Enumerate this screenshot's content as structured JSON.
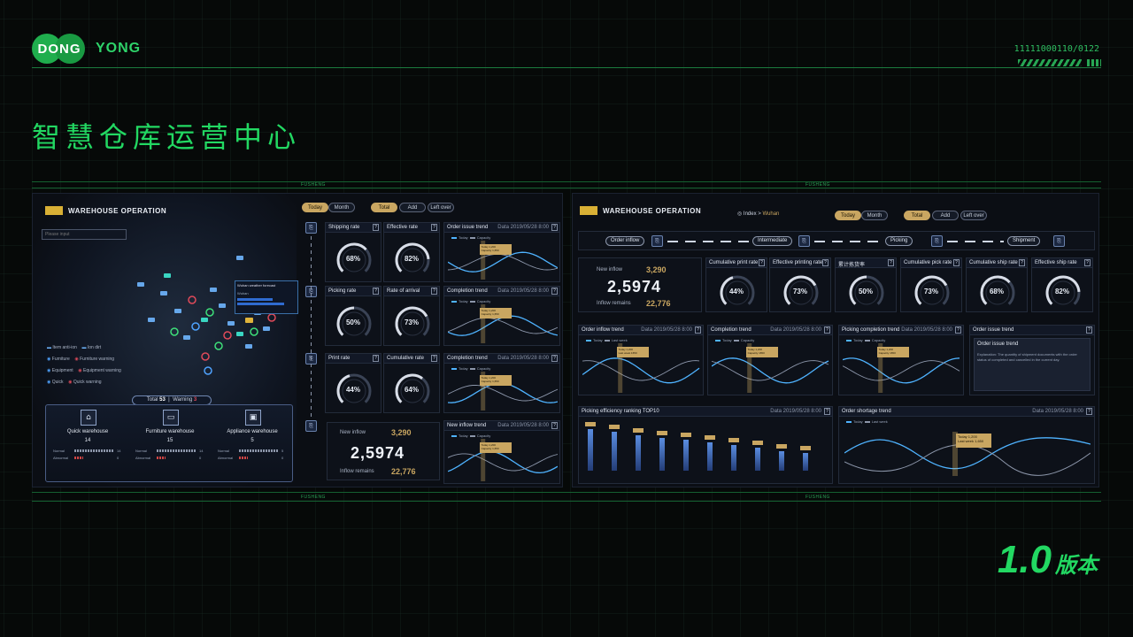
{
  "brand": {
    "left": "DONG",
    "right": "YONG"
  },
  "code": "11111000110/0122",
  "title": "智慧仓库运营中心",
  "rule_label": "FUSHENG",
  "version": {
    "number": "1.0",
    "suffix": "版本"
  },
  "colors": {
    "accent": "#22d862",
    "gold": "#c9a661",
    "panel": "#0d1119",
    "line": "#4fb3ff"
  },
  "left_screen": {
    "brand_title": "WAREHOUSE OPERATION",
    "search_placeholder": "Please input",
    "toggle": {
      "today": "Today",
      "month": "Month"
    },
    "tabs": {
      "total": "Total",
      "add": "Add",
      "leftover": "Left over"
    },
    "tooltip": {
      "title": "Wuhan weather forecast",
      "line2": "Wuhan"
    },
    "legend": [
      {
        "label": "Item anti-ion",
        "status": "Ion dirt"
      },
      {
        "label": "Furniture",
        "status": "Furniture warning"
      },
      {
        "label": "Equipment",
        "status": "Equipment warning"
      },
      {
        "label": "Quick",
        "status": "Quick warning"
      }
    ],
    "summary": {
      "total_label": "Total",
      "total": "53",
      "warning_label": "Warning",
      "warning": "3"
    },
    "warehouses": [
      {
        "name": "Quick warehouse",
        "value": "14",
        "unit": "",
        "normal_label": "Normal",
        "abnormal_label": "Abnormal",
        "normal_count": "14",
        "abnormal_count": "0"
      },
      {
        "name": "Furniture warehouse",
        "value": "15",
        "unit": "",
        "normal_label": "Normal",
        "abnormal_label": "Abnormal",
        "normal_count": "14",
        "abnormal_count": "0"
      },
      {
        "name": "Appliance warehouse",
        "value": "5",
        "unit": "",
        "normal_label": "Normal",
        "abnormal_label": "Abnormal",
        "normal_count": "5",
        "abnormal_count": "0"
      }
    ],
    "gauges": [
      {
        "label": "Shipping rate",
        "value": "68%",
        "pct": 68
      },
      {
        "label": "Effective rate",
        "value": "82%",
        "pct": 82
      },
      {
        "label": "Picking rate",
        "value": "50%",
        "pct": 50
      },
      {
        "label": "Rate of arrival",
        "value": "73%",
        "pct": 73
      },
      {
        "label": "Print rate",
        "value": "44%",
        "pct": 44
      },
      {
        "label": "Cumulative rate",
        "value": "64%",
        "pct": 64
      }
    ],
    "inflow": {
      "new_label": "New inflow",
      "new_value": "3,290",
      "new_unit": "b",
      "main": "2,5974",
      "main_unit": "b",
      "remain_label": "Inflow remains",
      "remain_value": "22,776",
      "remain_unit": "b"
    },
    "trends": [
      {
        "title": "Order issue trend",
        "date": "Data 2019/05/28 8:00",
        "legend": [
          "Today",
          "Capacity",
          "Last week"
        ],
        "tip1": "Today 1,200",
        "tip2": "Capacity 1,650"
      },
      {
        "title": "Completion trend",
        "date": "Data 2019/05/28 8:00",
        "legend": [
          "Today",
          "Capacity",
          "Last week"
        ],
        "tip1": "Today 1,200",
        "tip2": "Capacity 1,650"
      },
      {
        "title": "Completion trend",
        "date": "Data 2019/05/28 8:00",
        "legend": [
          "Today",
          "Capacity",
          "Last week"
        ],
        "tip1": "Today 1,200",
        "tip2": "Capacity 1,650"
      },
      {
        "title": "New inflow trend",
        "date": "Data 2019/05/28 8:00",
        "legend": [
          "Today",
          "Capacity",
          "Last week"
        ],
        "tip1": "Today 1,200",
        "tip2": "Capacity 1,650"
      }
    ]
  },
  "right_screen": {
    "brand_title": "WAREHOUSE OPERATION",
    "breadcrumb": {
      "root": "Index",
      "sep": ">",
      "city": "Wuhan"
    },
    "toggle": {
      "today": "Today",
      "month": "Month"
    },
    "tabs": {
      "total": "Total",
      "add": "Add",
      "leftover": "Left over"
    },
    "flow": [
      "Order inflow",
      "Intermediate",
      "Picking",
      "Shipment"
    ],
    "inflow": {
      "new_label": "New inflow",
      "new_value": "3,290",
      "new_unit": "Single",
      "main": "2,5974",
      "main_unit": "Single",
      "remain_label": "Inflow remains",
      "remain_value": "22,776",
      "remain_unit": "Single"
    },
    "gauges": [
      {
        "label": "Cumulative print rate",
        "value": "44%",
        "pct": 44
      },
      {
        "label": "Effective printing rate",
        "value": "73%",
        "pct": 73
      },
      {
        "label": "累计拣货率",
        "value": "50%",
        "pct": 50
      },
      {
        "label": "Cumulative pick rate",
        "value": "73%",
        "pct": 73
      },
      {
        "label": "Cumulative ship rate",
        "value": "68%",
        "pct": 68
      },
      {
        "label": "Effective ship rate",
        "value": "82%",
        "pct": 82
      }
    ],
    "trends": [
      {
        "title": "Order inflow trend",
        "date": "Data 2019/05/28 8:00",
        "legend": [
          "Today",
          "Last week"
        ],
        "tip1": "Today 1,200",
        "tip2": "Last week 1650"
      },
      {
        "title": "Completion trend",
        "date": "Data 2019/05/28 8:00",
        "legend": [
          "Today",
          "Capacity"
        ],
        "tip1": "Today 1,200",
        "tip2": "Capacity 1650"
      },
      {
        "title": "Picking completion trend",
        "date": "Data 2019/05/28 8:00",
        "legend": [
          "Today",
          "Capacity"
        ],
        "tip1": "Today 1,200",
        "tip2": "Capacity 1650"
      }
    ],
    "issue_box": {
      "title": "Order issue trend",
      "heading": "Order issue trend",
      "text": "Explanation: The quantity of shipment documents with the order status of completed and cancelled in the current day."
    },
    "ranking": {
      "title": "Picking efficiency ranking TOP10",
      "date": "Data 2019/05/28 8:00",
      "values": [
        95,
        88,
        80,
        75,
        70,
        64,
        58,
        52,
        45,
        40
      ]
    },
    "shortage": {
      "title": "Order shortage trend",
      "date": "Data 2019/05/28 8:00",
      "legend": [
        "Today",
        "Last week"
      ],
      "tip1": "Today 1,200",
      "tip2": "Last week 1,650"
    }
  }
}
